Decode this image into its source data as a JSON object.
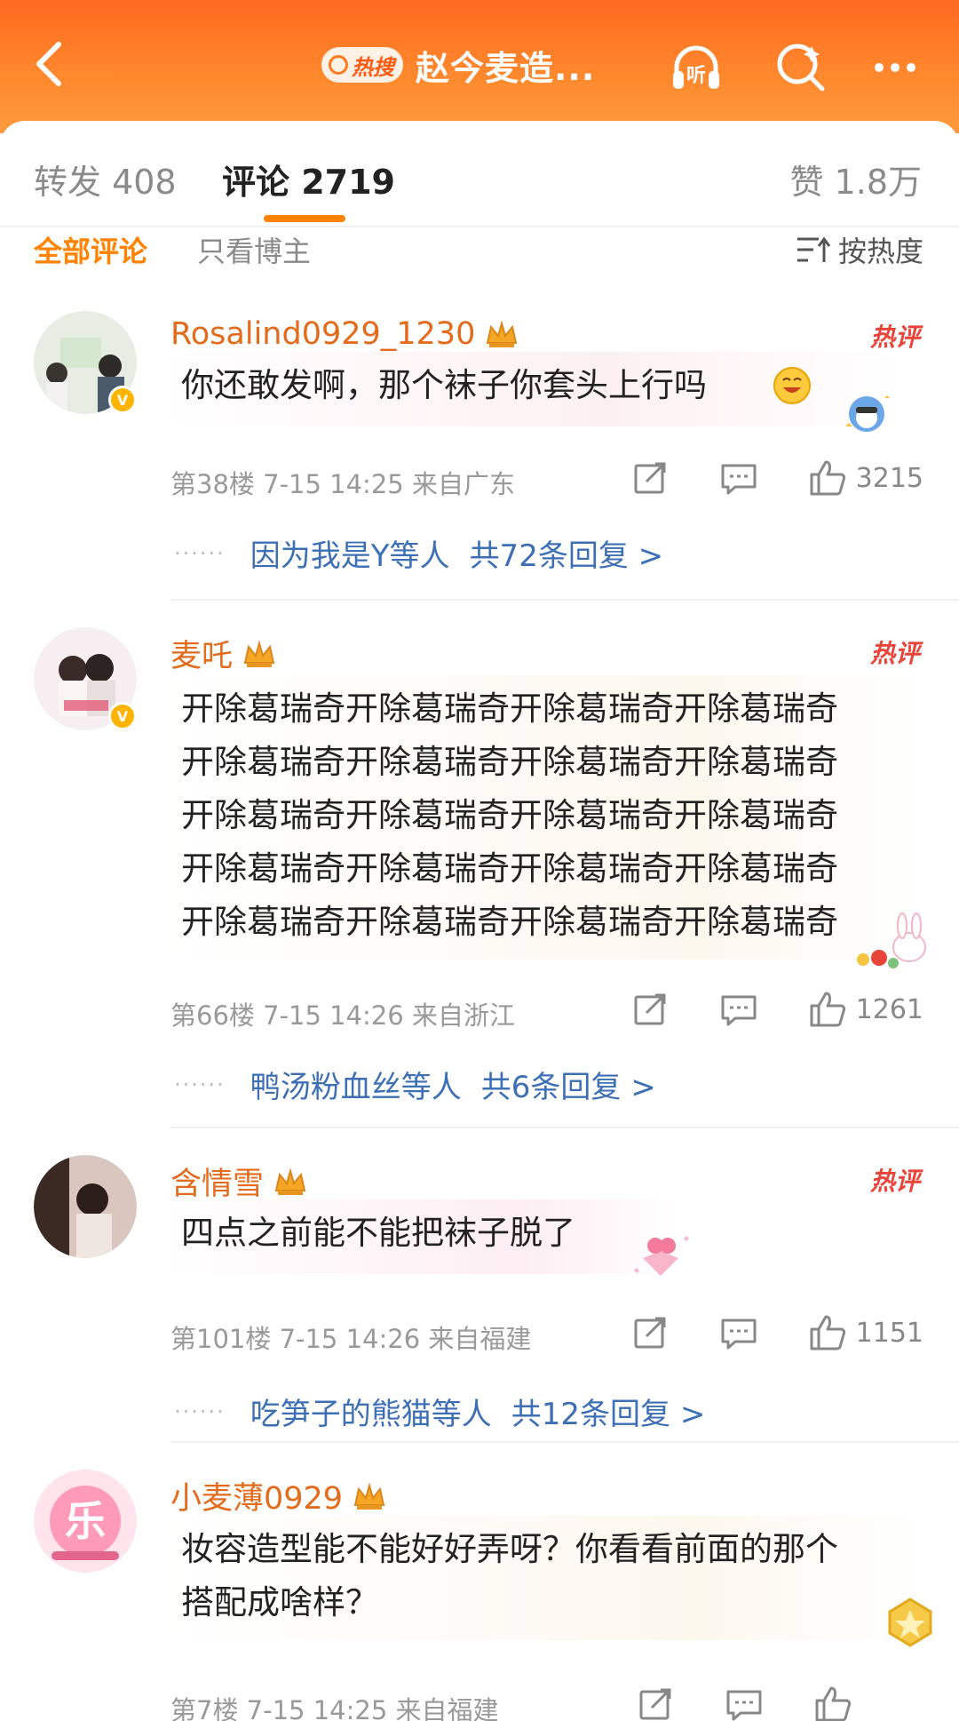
{
  "header": {
    "hot_tag": "热搜",
    "title": "赵今麦造...",
    "listen_label": "听"
  },
  "tabs": {
    "repost": "转发 408",
    "comment": "评论 2719",
    "like": "赞 1.8万"
  },
  "filter": {
    "all": "全部评论",
    "blogger_only": "只看博主",
    "sort": "按热度"
  },
  "comments": [
    {
      "username": "Rosalind0929_1230",
      "hot_label": "热评",
      "text": "你还敢发啊，那个袜子你套头上行吗",
      "meta": "第38楼 7-15 14:25 来自广东",
      "likes": "3215",
      "reply_names": "因为我是Y等人",
      "reply_count": "共72条回复 >"
    },
    {
      "username": "麦吒",
      "hot_label": "热评",
      "text_lines": [
        "开除葛瑞奇开除葛瑞奇开除葛瑞奇开除葛瑞奇",
        "开除葛瑞奇开除葛瑞奇开除葛瑞奇开除葛瑞奇",
        "开除葛瑞奇开除葛瑞奇开除葛瑞奇开除葛瑞奇",
        "开除葛瑞奇开除葛瑞奇开除葛瑞奇开除葛瑞奇",
        "开除葛瑞奇开除葛瑞奇开除葛瑞奇开除葛瑞奇"
      ],
      "meta": "第66楼 7-15 14:26 来自浙江",
      "likes": "1261",
      "reply_names": "鸭汤粉血丝等人",
      "reply_count": "共6条回复 >"
    },
    {
      "username": "含情雪",
      "hot_label": "热评",
      "text": "四点之前能不能把袜子脱了",
      "meta": "第101楼 7-15 14:26 来自福建",
      "likes": "1151",
      "reply_names": "吃笋子的熊猫等人",
      "reply_count": "共12条回复 >"
    },
    {
      "username": "小麦薄0929",
      "avatar_text": "乐",
      "text_lines": [
        "妆容造型能不能好好弄呀？你看看前面的那个",
        "搭配成啥样？"
      ],
      "meta": "第7楼 7-15 14:25 来自福建"
    }
  ],
  "colors": {
    "header_orange": "#ff6a1f",
    "accent": "#ff8200",
    "username": "#e26b1c",
    "hot": "#e8443a",
    "link": "#3d6fb5"
  }
}
